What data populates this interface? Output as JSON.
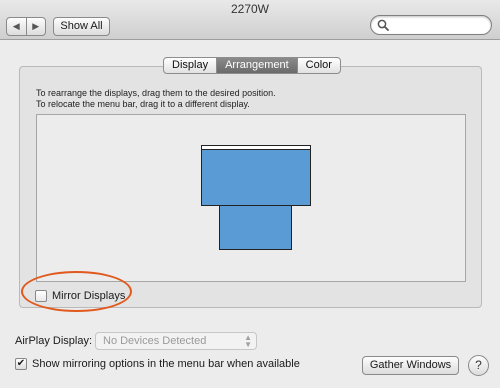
{
  "window": {
    "title": "2270W"
  },
  "toolbar": {
    "back_glyph": "◀",
    "forward_glyph": "▶",
    "show_all_label": "Show All",
    "search_placeholder": "",
    "search_value": ""
  },
  "tabs": [
    {
      "label": "Display",
      "active": false
    },
    {
      "label": "Arrangement",
      "active": true
    },
    {
      "label": "Color",
      "active": false
    }
  ],
  "instructions": {
    "line1": "To rearrange the displays, drag them to the desired position.",
    "line2": "To relocate the menu bar, drag it to a different display."
  },
  "arrangement": {
    "display_color": "#5b9bd5",
    "menubar_color": "#ffffff"
  },
  "mirror": {
    "label": "Mirror Displays",
    "checked": false
  },
  "highlight_color": "#e05a1e",
  "airplay": {
    "label": "AirPlay Display:",
    "selected": "No Devices Detected"
  },
  "show_mirroring": {
    "label": "Show mirroring options in the menu bar when available",
    "checked": true,
    "check_glyph": "✔"
  },
  "gather_windows_label": "Gather Windows",
  "help_glyph": "?"
}
